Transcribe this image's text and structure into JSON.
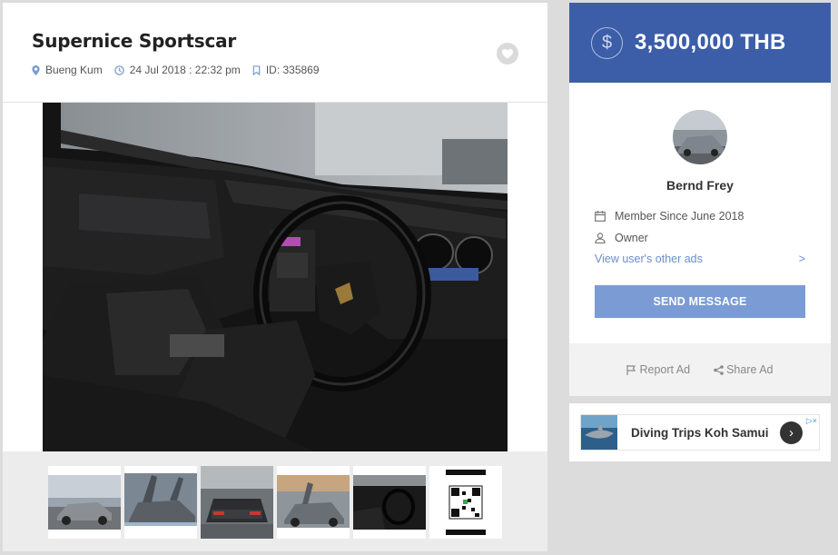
{
  "listing": {
    "title": "Supernice Sportscar",
    "location": "Bueng Kum",
    "date": "24 Jul 2018 : 22:32 pm",
    "id_text": "ID: 335869"
  },
  "gallery": {
    "thumbnails": [
      "car-front-grey",
      "car-doors-open",
      "car-rear",
      "car-gullwing",
      "car-interior",
      "qr-code"
    ]
  },
  "price": {
    "currency_icon": "$",
    "amount": "3,500,000 THB"
  },
  "seller": {
    "name": "Bernd Frey",
    "member_since": "Member Since June 2018",
    "role": "Owner",
    "other_ads_label": "View user's other ads",
    "other_ads_arrow": ">",
    "send_message_label": "SEND MESSAGE"
  },
  "actions": {
    "report_label": "Report Ad",
    "share_label": "Share Ad"
  },
  "promo": {
    "text": "Diving Trips Koh Samui",
    "arrow": "›",
    "adchoices": "▷×"
  },
  "colors": {
    "accent": "#3c5ea8",
    "button": "#7b9bd4",
    "link": "#6b8fc9",
    "meta_icon": "#7a9ccf"
  }
}
